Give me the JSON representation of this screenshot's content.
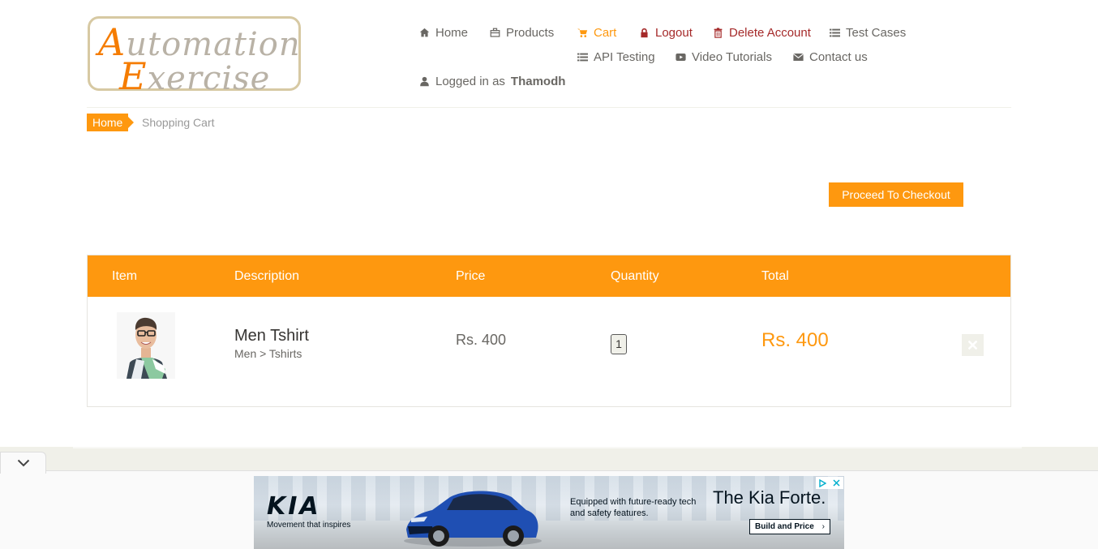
{
  "logo": {
    "line1_cap": "A",
    "line1_rest": "utomation",
    "line2_cap": "E",
    "line2_rest": "xercise"
  },
  "nav": {
    "home": "Home",
    "products": "Products",
    "cart": "Cart",
    "logout": "Logout",
    "delete_account": "Delete Account",
    "test_cases": "Test Cases",
    "api_testing": "API Testing",
    "video_tutorials": "Video Tutorials",
    "contact_us": "Contact us",
    "logged_in_prefix": "Logged in as",
    "username": "Thamodh"
  },
  "breadcrumb": {
    "home": "Home",
    "current": "Shopping Cart"
  },
  "checkout_button": "Proceed To Checkout",
  "cart": {
    "headers": [
      "Item",
      "Description",
      "Price",
      "Quantity",
      "Total"
    ],
    "rows": [
      {
        "name": "Men Tshirt",
        "category": "Men > Tshirts",
        "price": "Rs. 400",
        "quantity": "1",
        "total": "Rs. 400"
      }
    ]
  },
  "ad": {
    "brand": "KIA",
    "tagline": "Movement that inspires",
    "copy": "Equipped with future-ready tech and safety features.",
    "headline": "The Kia Forte.",
    "cta": "Build and Price",
    "cta_arrow": "›"
  },
  "colors": {
    "accent": "#fe980f",
    "danger": "#a52a2a",
    "text": "#696763"
  }
}
